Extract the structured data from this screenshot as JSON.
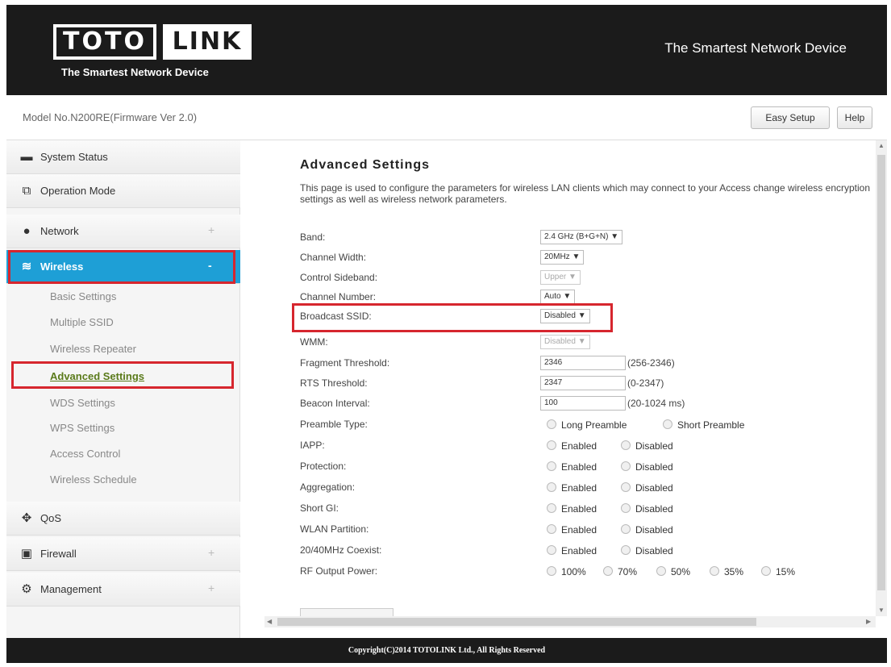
{
  "header": {
    "logo_left": "TOTO",
    "logo_right": "LINK",
    "logo_sub": "The Smartest Network Device",
    "tagline": "The Smartest Network Device"
  },
  "modelbar": {
    "model": "Model No.N200RE(Firmware Ver 2.0)",
    "easy_setup": "Easy Setup",
    "help": "Help"
  },
  "sidebar": {
    "items": [
      {
        "label": "System Status",
        "icon": "chat-icon",
        "glyph": "▬"
      },
      {
        "label": "Operation Mode",
        "icon": "monitor-icon",
        "glyph": "⧉"
      },
      {
        "label": "Network",
        "icon": "globe-icon",
        "glyph": "●",
        "expand": "+"
      },
      {
        "label": "Wireless",
        "icon": "wifi-icon",
        "glyph": "≋",
        "expand": "-"
      },
      {
        "label": "QoS",
        "icon": "qos-icon",
        "glyph": "✥"
      },
      {
        "label": "Firewall",
        "icon": "lock-icon",
        "glyph": "▣",
        "expand": "+"
      },
      {
        "label": "Management",
        "icon": "gear-icon",
        "glyph": "⚙",
        "expand": "+"
      }
    ],
    "wireless_sub": [
      "Basic Settings",
      "Multiple SSID",
      "Wireless Repeater",
      "Advanced Settings",
      "WDS Settings",
      "WPS Settings",
      "Access Control",
      "Wireless Schedule"
    ]
  },
  "main": {
    "title": "Advanced Settings",
    "description": "This page is used to configure the parameters for wireless LAN clients which may connect to your Access change wireless encryption settings as well as wireless network parameters.",
    "band_label": "Band:",
    "band_value": "2.4 GHz (B+G+N) ▼",
    "channel_width_label": "Channel Width:",
    "channel_width_value": "20MHz ▼",
    "control_sideband_label": "Control Sideband:",
    "control_sideband_value": "Upper ▼",
    "channel_number_label": "Channel Number:",
    "channel_number_value": "Auto ▼",
    "broadcast_ssid_label": "Broadcast SSID:",
    "broadcast_ssid_value": "Disabled ▼",
    "wmm_label": "WMM:",
    "wmm_value": "Disabled ▼",
    "fragment_label": "Fragment Threshold:",
    "fragment_value": "2346",
    "fragment_range": "(256-2346)",
    "rts_label": "RTS Threshold:",
    "rts_value": "2347",
    "rts_range": "(0-2347)",
    "beacon_label": "Beacon Interval:",
    "beacon_value": "100",
    "beacon_range": "(20-1024 ms)",
    "preamble_label": "Preamble Type:",
    "preamble_long": "Long Preamble",
    "preamble_short": "Short Preamble",
    "iapp_label": "IAPP:",
    "protection_label": "Protection:",
    "aggregation_label": "Aggregation:",
    "shortgi_label": "Short GI:",
    "wlan_partition_label": "WLAN Partition:",
    "coexist_label": "20/40MHz Coexist:",
    "enabled": "Enabled",
    "disabled": "Disabled",
    "rf_label": "RF Output Power:",
    "rf_100": "100%",
    "rf_70": "70%",
    "rf_50": "50%",
    "rf_35": "35%",
    "rf_15": "15%"
  },
  "footer": {
    "copyright": "Copyright(C)2014 TOTOLINK Ltd., All Rights Reserved"
  }
}
